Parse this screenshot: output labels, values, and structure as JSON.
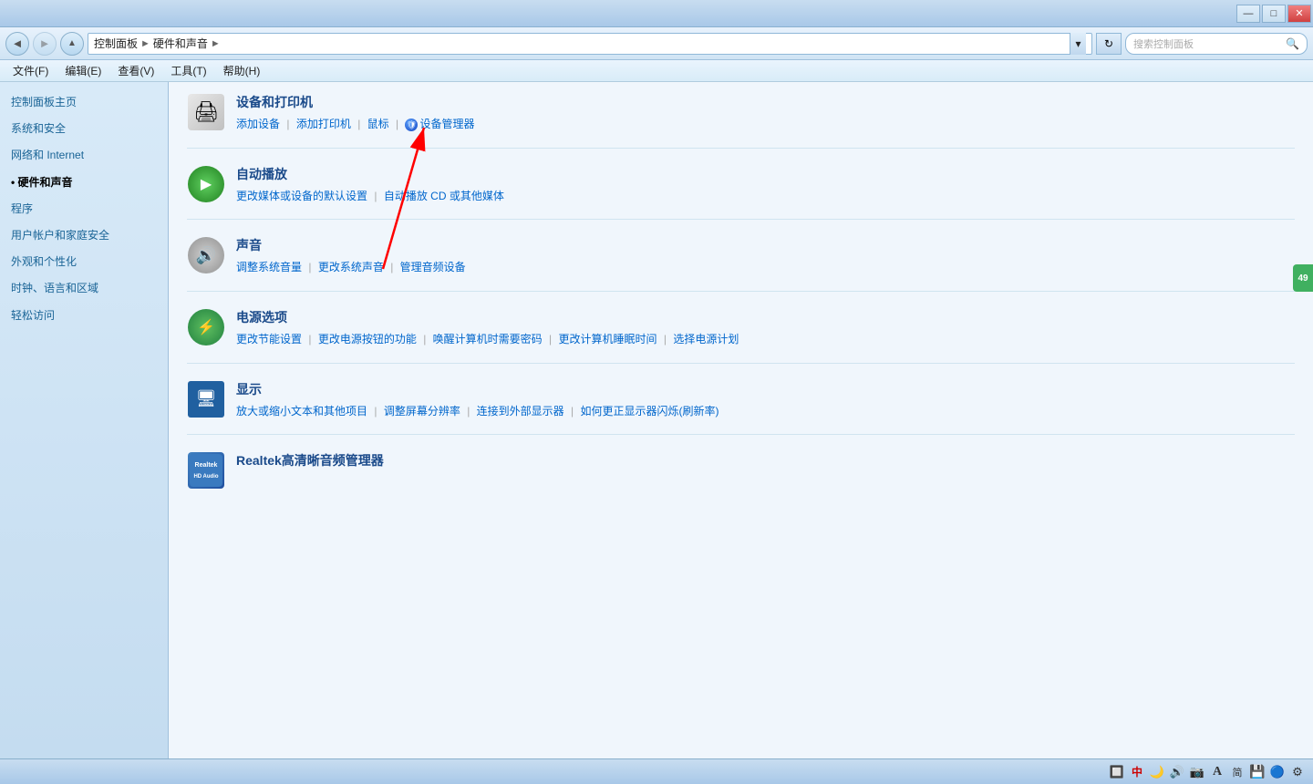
{
  "titlebar": {
    "minimize_label": "—",
    "maximize_label": "□",
    "close_label": "✕"
  },
  "addressbar": {
    "back_icon": "◄",
    "forward_icon": "►",
    "up_icon": "▲",
    "path": {
      "root": "控制面板",
      "current": "硬件和声音"
    },
    "refresh_icon": "↻",
    "search_placeholder": "搜索控制面板",
    "dropdown_icon": "▾",
    "path_arrow": "►"
  },
  "menubar": {
    "items": [
      {
        "label": "文件(F)"
      },
      {
        "label": "编辑(E)"
      },
      {
        "label": "查看(V)"
      },
      {
        "label": "工具(T)"
      },
      {
        "label": "帮助(H)"
      }
    ]
  },
  "sidebar": {
    "items": [
      {
        "label": "控制面板主页",
        "active": false
      },
      {
        "label": "系统和安全",
        "active": false
      },
      {
        "label": "网络和 Internet",
        "active": false
      },
      {
        "label": "硬件和声音",
        "active": true
      },
      {
        "label": "程序",
        "active": false
      },
      {
        "label": "用户帐户和家庭安全",
        "active": false
      },
      {
        "label": "外观和个性化",
        "active": false
      },
      {
        "label": "时钟、语言和区域",
        "active": false
      },
      {
        "label": "轻松访问",
        "active": false
      }
    ]
  },
  "content": {
    "categories": [
      {
        "id": "devices",
        "title": "设备和打印机",
        "links_row1": [
          {
            "label": "添加设备"
          },
          {
            "label": "添加打印机"
          },
          {
            "label": "鼠标"
          },
          {
            "label": "设备管理器",
            "has_shield": true
          }
        ],
        "links_row2": []
      },
      {
        "id": "autoplay",
        "title": "自动播放",
        "links_row1": [
          {
            "label": "更改媒体或设备的默认设置"
          },
          {
            "label": "自动播放 CD 或其他媒体"
          }
        ]
      },
      {
        "id": "sound",
        "title": "声音",
        "links_row1": [
          {
            "label": "调整系统音量"
          },
          {
            "label": "更改系统声音"
          },
          {
            "label": "管理音频设备"
          }
        ]
      },
      {
        "id": "power",
        "title": "电源选项",
        "links_row1": [
          {
            "label": "更改节能设置"
          },
          {
            "label": "更改电源按钮的功能"
          },
          {
            "label": "唤醒计算机时需要密码"
          },
          {
            "label": "更改计算机睡眠时间"
          },
          {
            "label": "选择电源计划"
          }
        ]
      },
      {
        "id": "display",
        "title": "显示",
        "links_row1": [
          {
            "label": "放大或缩小文本和其他项目"
          },
          {
            "label": "调整屏幕分辨率"
          },
          {
            "label": "连接到外部显示器"
          },
          {
            "label": "如何更正显示器闪烁(刷新率)"
          }
        ]
      },
      {
        "id": "realtek",
        "title": "Realtek高清晰音频管理器",
        "links_row1": []
      }
    ]
  },
  "taskbar": {
    "icons": [
      "🔲",
      "中",
      "🌙",
      "🔊",
      "📷",
      "A",
      "简",
      "💾",
      "🔵",
      "⚙"
    ]
  },
  "floatbtn": {
    "label": "49"
  }
}
